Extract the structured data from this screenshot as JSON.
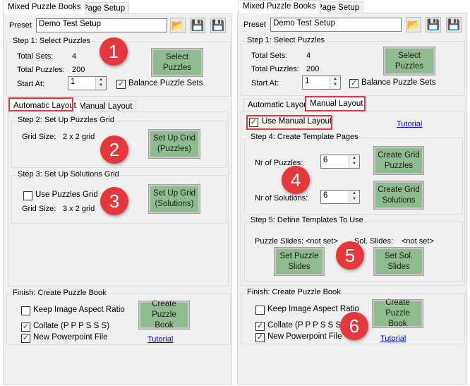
{
  "tabs": {
    "mixed": "Mixed Puzzle Books",
    "page_setup": "Page Setup"
  },
  "preset": {
    "label": "Preset",
    "value": "Demo Test Setup"
  },
  "step1": {
    "title": "Step 1: Select Puzzles",
    "total_sets_label": "Total Sets:",
    "total_sets": "4",
    "total_puzzles_label": "Total Puzzles:",
    "total_puzzles": "200",
    "start_at_label": "Start At:",
    "start_at": "1",
    "select_button": "Select Puzzles",
    "balance_label": "Balance Puzzle Sets",
    "balance_checked": true
  },
  "layout_tabs": {
    "automatic": "Automatic Layout",
    "manual": "Manual Layout"
  },
  "step2": {
    "title": "Step 2: Set Up Puzzles Grid",
    "grid_size_label": "Grid Size:",
    "grid_size": "2 x 2 grid",
    "button": "Set Up Grid (Puzzles)"
  },
  "step3": {
    "title": "Step 3: Set Up Solutions Grid",
    "use_puzzles_grid": "Use Puzzles Grid",
    "use_puzzles_grid_checked": false,
    "grid_size_label": "Grid Size:",
    "grid_size": "3 x 2 grid",
    "button": "Set Up Grid (Solutions)"
  },
  "manual": {
    "use_manual_layout": "Use Manual Layout",
    "checked": true,
    "tutorial": "Tutorial"
  },
  "step4": {
    "title": "Step 4: Create Template Pages",
    "nr_puzzles_label": "Nr of Puzzles:",
    "nr_puzzles": "6",
    "nr_solutions_label": "Nr of Solutions:",
    "nr_solutions": "6",
    "create_puzzles": "Create Grid Puzzles",
    "create_solutions": "Create Grid Solutions"
  },
  "step5": {
    "title": "Step 5: Define Templates To Use",
    "puzzle_slides_label": "Puzzle Slides:",
    "puzzle_slides": "<not set>",
    "sol_slides_label": "Sol. Slides:",
    "sol_slides": "<not set>",
    "set_puzzle": "Set Puzzle Slides",
    "set_sol": "Set Sol. Slides"
  },
  "finish": {
    "title": "Finish: Create Puzzle Book",
    "keep_aspect": "Keep Image Aspect Ratio",
    "keep_aspect_checked": false,
    "collate": "Collate (P P P S S S)",
    "collate_checked": true,
    "new_ppt": "New Powerpoint File",
    "new_ppt_checked": true,
    "button": "Create Puzzle Book",
    "tutorial": "Tutorial"
  },
  "badges": [
    "1",
    "2",
    "3",
    "4",
    "5",
    "6"
  ],
  "colors": {
    "button_green": "#8fbc8f",
    "badge_red": "#e5383d",
    "highlight": "#e5383d"
  },
  "icons": {
    "open": "folder-icon",
    "save": "save-icon",
    "save_new": "save-add-icon"
  }
}
